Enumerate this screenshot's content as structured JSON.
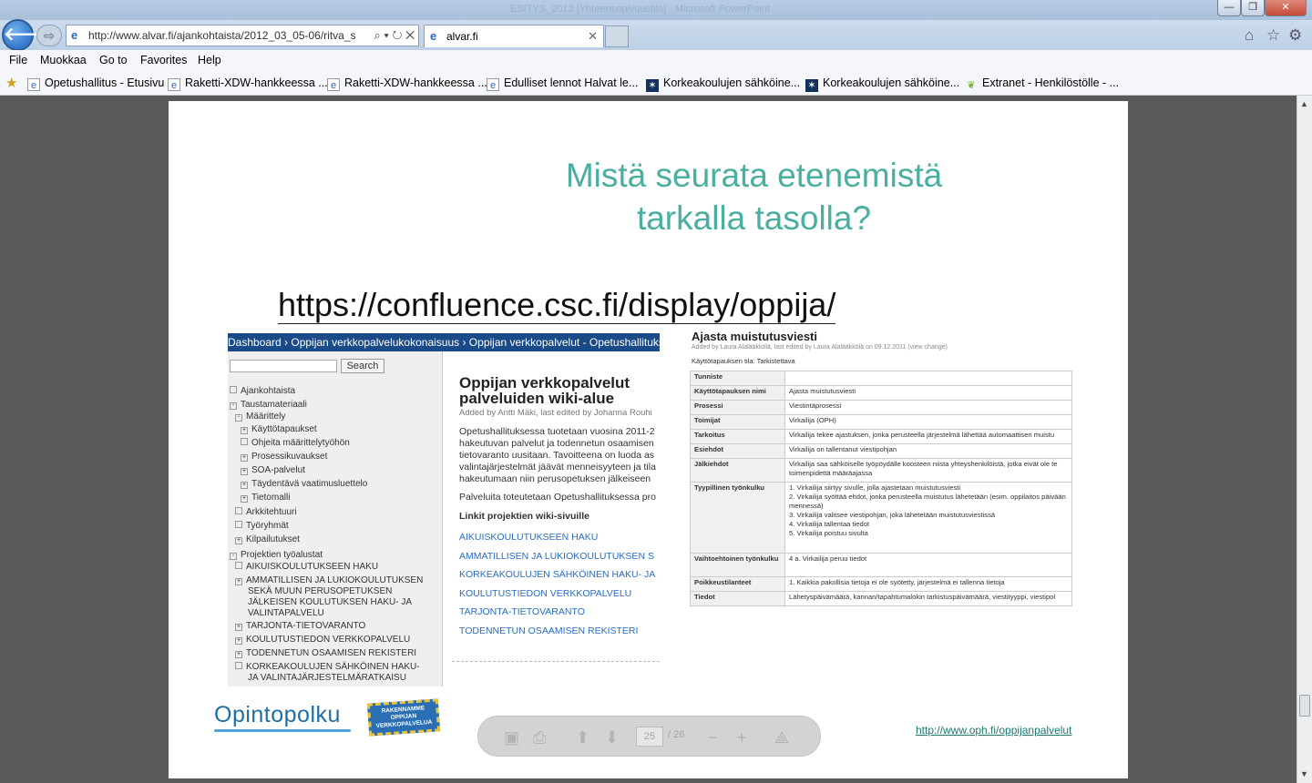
{
  "window": {
    "title": "ESITYS_2012 [Yhteensopivuustila] - Microsoft PowerPoint"
  },
  "address_bar": {
    "url": "http://www.alvar.fi/ajankohtaista/2012_03_05-06/ritva_s"
  },
  "tab": {
    "label": "alvar.fi"
  },
  "menu": [
    "File",
    "Muokkaa",
    "Go to",
    "Favorites",
    "Help"
  ],
  "favorites": [
    {
      "label": "Opetushallitus - Etusivu",
      "icon": "ie-page-icon"
    },
    {
      "label": "Raketti-XDW-hankkeessa ...",
      "icon": "ie-page-icon"
    },
    {
      "label": "Raketti-XDW-hankkeessa ...",
      "icon": "ie-page-icon"
    },
    {
      "label": "Edulliset lennot  Halvat le...",
      "icon": "ie-page-icon"
    },
    {
      "label": "Korkeakoulujen sähköine...",
      "icon": "star-logo-icon"
    },
    {
      "label": "Korkeakoulujen sähköine...",
      "icon": "star-logo-icon"
    },
    {
      "label": "Extranet - Henkilöstölle - ...",
      "icon": "leaf-icon"
    }
  ],
  "slide": {
    "title_line1": "Mistä seurata etenemistä",
    "title_line2": "tarkalla tasolla?",
    "link": "https://confluence.csc.fi/display/oppija/",
    "oph_link": "http://www.oph.fi/oppijanpalvelut",
    "logo_text": "Opintopolku",
    "stamp_text": "RAKENNAMME OPPIJAN VERKKOPALVELUA",
    "title_color": "#4aaea0"
  },
  "wiki_screenshot": {
    "breadcrumb": "Dashboard › Oppijan verkkopalvelukokonaisuus › Oppijan verkkopalvelut - Opetushallituksessa to",
    "search_label": "Search",
    "tree": [
      {
        "label": "Ajankohtaista",
        "indent": 0,
        "box": ""
      },
      {
        "label": "Taustamateriaali",
        "indent": 0,
        "box": "-"
      },
      {
        "label": "Määrittely",
        "indent": 1,
        "box": "-"
      },
      {
        "label": "Käyttötapaukset",
        "indent": 2,
        "box": "+"
      },
      {
        "label": "Ohjeita määrittelytyöhön",
        "indent": 2,
        "box": ""
      },
      {
        "label": "Prosessikuvaukset",
        "indent": 2,
        "box": "+"
      },
      {
        "label": "SOA-palvelut",
        "indent": 2,
        "box": "+"
      },
      {
        "label": "Täydentävä vaatimusluettelo",
        "indent": 2,
        "box": "+"
      },
      {
        "label": "Tietomalli",
        "indent": 2,
        "box": "+"
      },
      {
        "label": "Arkkitehtuuri",
        "indent": 1,
        "box": ""
      },
      {
        "label": "Työryhmät",
        "indent": 1,
        "box": ""
      },
      {
        "label": "Kilpailutukset",
        "indent": 1,
        "box": "+"
      },
      {
        "label": "Projektien työalustat",
        "indent": 0,
        "box": "-"
      },
      {
        "label": "AIKUISKOULUTUKSEEN HAKU",
        "indent": 1,
        "box": ""
      },
      {
        "label": "AMMATILLISEN JA LUKIOKOULUTUKSEN",
        "indent": 1,
        "box": "+"
      },
      {
        "label": "SEKÄ MUUN PERUSOPETUKSEN",
        "indent": 1,
        "box": "cont"
      },
      {
        "label": "JÄLKEISEN KOULUTUKSEN HAKU- JA",
        "indent": 1,
        "box": "cont"
      },
      {
        "label": "VALINTAPALVELU",
        "indent": 1,
        "box": "cont"
      },
      {
        "label": "TARJONTA-TIETOVARANTO",
        "indent": 1,
        "box": "+"
      },
      {
        "label": "KOULUTUSTIEDON VERKKOPALVELU",
        "indent": 1,
        "box": "+"
      },
      {
        "label": "TODENNETUN OSAAMISEN REKISTERI",
        "indent": 1,
        "box": "+"
      },
      {
        "label": "KORKEAKOULUJEN SÄHKÖINEN HAKU-",
        "indent": 1,
        "box": ""
      },
      {
        "label": "JA VALINTAJÄRJESTELMÄRATKAISU",
        "indent": 1,
        "box": "cont"
      }
    ],
    "page_title_1": "Oppijan verkkopalvelut",
    "page_title_2": "palveluiden wiki-alue",
    "added_by": "Added by Antti Mäki, last edited by Johanna Rouhi",
    "body": [
      "Opetushallituksessa tuotetaan vuosina 2011-2",
      "hakeutuvan palvelut ja todennetun osaamisen",
      "tietovaranto uusitaan. Tavoitteena on luoda as",
      "valintajärjestelmät jäävät menneisyyteen ja tila",
      "hakeutumaan niin perusopetuksen jälkeiseen"
    ],
    "body2": "Palveluita toteutetaan Opetushallituksessa pro",
    "links_heading": "Linkit projektien wiki-sivuille",
    "links": [
      "AIKUISKOULUTUKSEEN HAKU",
      "AMMATILLISEN JA LUKIOKOULUTUKSEN S",
      "KORKEAKOULUJEN SÄHKÖINEN HAKU- JA",
      "KOULUTUSTIEDON VERKKOPALVELU",
      "TARJONTA-TIETOVARANTO",
      "TODENNETUN OSAAMISEN REKISTERI"
    ]
  },
  "usecase_screenshot": {
    "title": "Ajasta muistutusviesti",
    "meta": "Added by Laura Alalääkkölä, last edited by Laura Alalääkkölä on 09.12.2011  (view change)",
    "status": "Käyttötapauksen tila: Tarkistettava",
    "rows": [
      {
        "k": "Tunniste",
        "v": ""
      },
      {
        "k": "Käyttötapauksen nimi",
        "v": "Ajasta muistutusviesti"
      },
      {
        "k": "Prosessi",
        "v": "Viestintäprosessi"
      },
      {
        "k": "Toimijat",
        "v": "Virkailija (OPH)"
      },
      {
        "k": "Tarkoitus",
        "v": "Virkailija tekee ajastuksen, jonka perusteella järjestelmä lähettää automaattisen muistu"
      },
      {
        "k": "Esiehdot",
        "v": "Virkailija on tallentanut viestipohjan"
      },
      {
        "k": "Jälkiehdot",
        "v": "Virkailija saa sähköiselle työpöydälle koosteen niista yhteyshenkilöistä, jotka eivät ole te toimenpidettä määräajassa"
      },
      {
        "k": "Tyypillinen työnkulku",
        "v": "1. Virkailija siirtyy sivulle, jolla ajastetaan muistutusviesti\n2. Virkailija syöttää ehdot, jonka perusteella muistutus lähetetään (esim. oppilaitos päivään mennessä)\n3. Virkailija valitsee viestipohjan, joka lähetetään muistutusviestissä\n4. Virkailija tallentaa tiedot\n5. Virkailija poistuu sivulta"
      },
      {
        "k": "Vaihtoehtoinen työnkulku",
        "v": "4 a. Virkailija peruu tiedot"
      },
      {
        "k": "Poikkeustilanteet",
        "v": "1. Kaikkia pakollisia tietoja ei ole syötetty, järjestelmä ei tallenna tietoja"
      },
      {
        "k": "Tiedot",
        "v": "Lähetyspäivämäärä, kannan/tapahtumalokin tarkistuspäivämäärä, viestityyppi, viestipol"
      }
    ]
  },
  "pdf_toolbar": {
    "page": "25",
    "total": "/ 26"
  }
}
